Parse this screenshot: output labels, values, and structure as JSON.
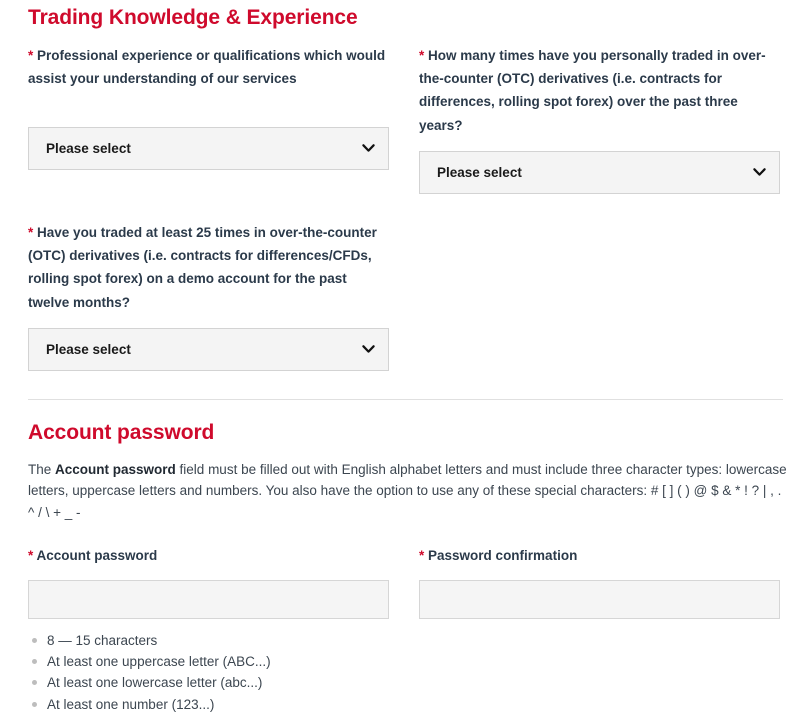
{
  "theme": {
    "accent_red": "#cf0a2c",
    "label_color": "#2b3a4a",
    "field_bg": "#f4f4f4",
    "field_border": "#d3d3d3",
    "bullet_color": "#bdbdbd"
  },
  "trading_section": {
    "title": "Trading Knowledge & Experience",
    "required_marker": "*",
    "questions": [
      {
        "label": "Professional experience or qualifications which would assist your understanding of our services",
        "select_value": "Please select",
        "options": [
          "Please select"
        ]
      },
      {
        "label": "How many times have you personally traded in over-the-counter (OTC) derivatives (i.e. contracts for differences, rolling spot forex) over the past three years?",
        "select_value": "Please select",
        "options": [
          "Please select"
        ]
      },
      {
        "label": "Have you traded at least 25 times in over-the-counter (OTC) derivatives (i.e. contracts for differences/CFDs, rolling spot forex) on a demo account for the past twelve months?",
        "select_value": "Please select",
        "options": [
          "Please select"
        ]
      }
    ]
  },
  "password_section": {
    "title": "Account password",
    "description_prefix": "The ",
    "description_bold": "Account password",
    "description_rest": " field must be filled out with English alphabet letters and must include three character types: lowercase letters, uppercase letters and numbers. You also have the option to use any of these special characters: # [ ] ( ) @ $ & * ! ? | , . ^ / \\ + _ -",
    "password_label": "Account password",
    "password_value": "",
    "password_placeholder": "",
    "confirm_label": "Password confirmation",
    "confirm_value": "",
    "confirm_placeholder": "",
    "requirements": [
      "8 — 15 characters",
      "At least one uppercase letter (ABC...)",
      "At least one lowercase letter (abc...)",
      "At least one number (123...)"
    ]
  }
}
